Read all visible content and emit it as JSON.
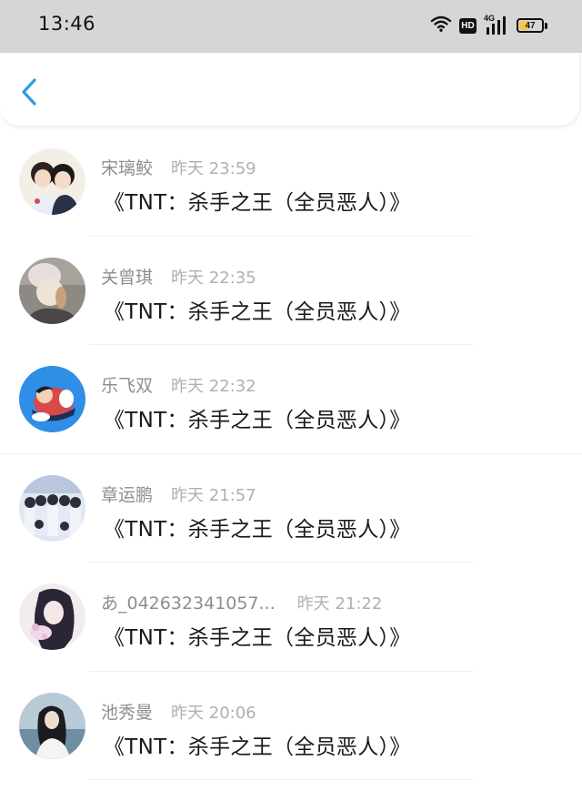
{
  "status_bar": {
    "time": "13:46",
    "hd_label": "HD",
    "network_label": "4G",
    "battery_level": "47",
    "battery_color": "#f2cb4d"
  },
  "header": {
    "back_icon": "chevron-left-icon",
    "accent_color": "#2d9be4"
  },
  "messages": [
    {
      "name": "宋璃鲛",
      "time": "昨天 23:59",
      "text": "《TNT：杀手之王（全员恶人）》",
      "avatar": "anime-couple"
    },
    {
      "name": "关曾琪",
      "time": "昨天 22:35",
      "text": "《TNT：杀手之王（全员恶人）》",
      "avatar": "hooded-person"
    },
    {
      "name": "乐飞双",
      "time": "昨天 22:32",
      "text": "《TNT：杀手之王（全员恶人）》",
      "avatar": "cartoon-on-blue"
    },
    {
      "name": "章运鹏",
      "time": "昨天 21:57",
      "text": "《TNT：杀手之王（全员恶人）》",
      "avatar": "group-photo"
    },
    {
      "name": "あ_042632341057...",
      "time": "昨天 21:22",
      "text": "《TNT：杀手之王（全员恶人）》",
      "avatar": "anime-girl"
    },
    {
      "name": "池秀曼",
      "time": "昨天 20:06",
      "text": "《TNT：杀手之王（全员恶人）》",
      "avatar": "girl-by-sea"
    }
  ]
}
